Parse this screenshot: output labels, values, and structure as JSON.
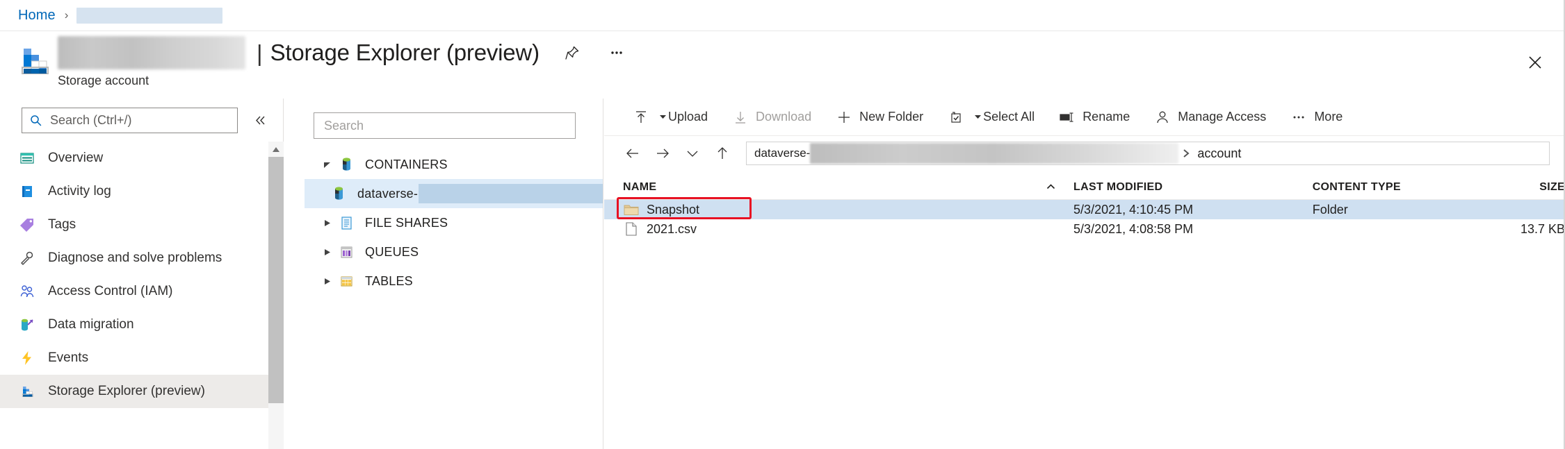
{
  "breadcrumb": {
    "home_label": "Home",
    "separator": "›",
    "redacted": ""
  },
  "header": {
    "resource_name_redacted": "",
    "pipe": "|",
    "title": "Storage Explorer (preview)",
    "subtitle": "Storage account",
    "pin_icon": "pin-icon",
    "more_icon": "ellipsis-icon",
    "close_icon": "close-icon",
    "account_icon": "storage-account-icon"
  },
  "sidebar": {
    "search": {
      "placeholder": "Search (Ctrl+/)",
      "value": "",
      "icon": "search-icon"
    },
    "collapse_icon": "chevron-double-left-icon",
    "items": [
      {
        "label": "Overview",
        "icon": "overview-icon",
        "selected": false
      },
      {
        "label": "Activity log",
        "icon": "activity-log-icon",
        "selected": false
      },
      {
        "label": "Tags",
        "icon": "tag-icon",
        "selected": false
      },
      {
        "label": "Diagnose and solve problems",
        "icon": "wrench-icon",
        "selected": false
      },
      {
        "label": "Access Control (IAM)",
        "icon": "people-icon",
        "selected": false
      },
      {
        "label": "Data migration",
        "icon": "data-migration-icon",
        "selected": false
      },
      {
        "label": "Events",
        "icon": "lightning-icon",
        "selected": false
      },
      {
        "label": "Storage Explorer (preview)",
        "icon": "storage-explorer-icon",
        "selected": true
      }
    ]
  },
  "tree": {
    "search": {
      "placeholder": "Search",
      "value": ""
    },
    "nodes": [
      {
        "label": "CONTAINERS",
        "icon": "container-icon",
        "expanded": true,
        "selected": false,
        "child": false
      },
      {
        "label": "dataverse-",
        "icon": "container-icon",
        "expanded": null,
        "selected": true,
        "child": true
      },
      {
        "label": "FILE SHARES",
        "icon": "file-share-icon",
        "expanded": false,
        "selected": false,
        "child": false
      },
      {
        "label": "QUEUES",
        "icon": "queue-icon",
        "expanded": false,
        "selected": false,
        "child": false
      },
      {
        "label": "TABLES",
        "icon": "table-icon",
        "expanded": false,
        "selected": false,
        "child": false
      }
    ]
  },
  "toolbar": {
    "buttons": [
      {
        "label": "Upload",
        "icon": "upload-icon",
        "caret": true,
        "disabled": false
      },
      {
        "label": "Download",
        "icon": "download-icon",
        "caret": false,
        "disabled": true
      },
      {
        "label": "New Folder",
        "icon": "plus-icon",
        "caret": false,
        "disabled": false
      },
      {
        "label": "Select All",
        "icon": "select-all-icon",
        "caret": true,
        "disabled": false
      },
      {
        "label": "Rename",
        "icon": "rename-icon",
        "caret": false,
        "disabled": false
      },
      {
        "label": "Manage Access",
        "icon": "person-icon",
        "caret": false,
        "disabled": false
      },
      {
        "label": "More",
        "icon": "ellipsis-icon",
        "caret": false,
        "disabled": false
      }
    ]
  },
  "address": {
    "back_icon": "arrow-left-icon",
    "forward_icon": "arrow-right-icon",
    "history_icon": "chevron-down-icon",
    "up_icon": "arrow-up-icon",
    "container_label": "dataverse-",
    "container_redacted": "",
    "chevron": "❯",
    "folder_label": "account"
  },
  "file_table": {
    "columns": [
      "NAME",
      "LAST MODIFIED",
      "CONTENT TYPE",
      "SIZE"
    ],
    "sort_column": "NAME",
    "sort_direction": "asc",
    "sort_icon": "caret-up-icon",
    "rows": [
      {
        "name": "Snapshot",
        "icon": "folder-icon",
        "last_modified": "5/3/2021, 4:10:45 PM",
        "content_type": "Folder",
        "size": "",
        "selected": true,
        "highlighted": true
      },
      {
        "name": "2021.csv",
        "icon": "file-icon",
        "last_modified": "5/3/2021, 4:08:58 PM",
        "content_type": "",
        "size": "13.7 KB",
        "selected": false,
        "highlighted": false
      }
    ]
  },
  "colors": {
    "link_blue": "#0067b8",
    "selection_blue": "#cfe0f1",
    "tree_selection": "#deecf9",
    "nav_selected": "#edebe9",
    "highlight_red": "#e81123",
    "crumb_redacted": "#d6e3f0"
  }
}
